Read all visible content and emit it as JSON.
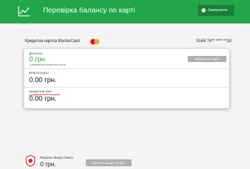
{
  "header": {
    "title": "Перевірка балансу по карті",
    "exit_label": "Завершити",
    "icons": {
      "logo": "line-chart-icon",
      "exit": "power-icon"
    }
  },
  "card": {
    "name": "Кредитна картка MasterCard",
    "brand_logo": "mastercard-logo",
    "number": "5168 74** **** **18"
  },
  "balances": {
    "available": {
      "label": "Доступно",
      "value": "0 грн.",
      "note": "з урахуванням кредитних коштів",
      "statement_label": "Виписка по карті"
    },
    "own_funds": {
      "label": "Власні кошти",
      "value": "0.00 грн."
    },
    "credit_limit": {
      "label": "Кредитний ліміт",
      "value": "0.00 грн."
    }
  },
  "bonus": {
    "label": "Рахунок «Бонус Плюс»",
    "value": "0 грн.",
    "catalog_label": "Каталог «Бонус Плюс»",
    "icon": "bonus-badge-icon"
  },
  "colors": {
    "brand_green": "#22a64a",
    "exit_button": "#1a7d38",
    "grey_button": "#aeb0b3",
    "annotation_red": "#cc2a2a"
  }
}
